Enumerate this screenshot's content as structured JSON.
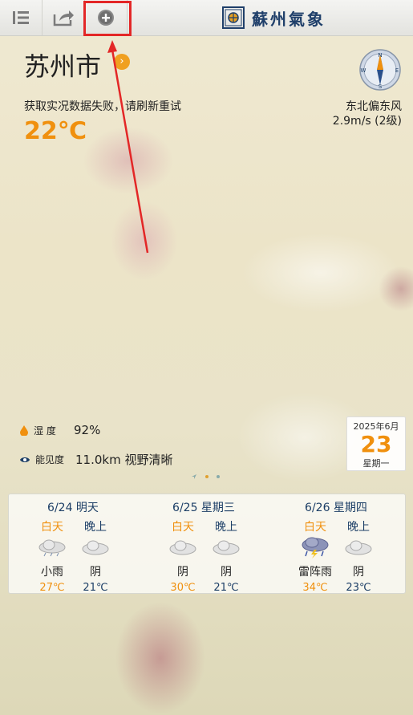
{
  "header": {
    "logo_text": "蘇州氣象",
    "buttons": [
      {
        "name": "menu-icon"
      },
      {
        "name": "share-icon"
      },
      {
        "name": "add-city-icon"
      }
    ]
  },
  "current": {
    "city": "苏州市",
    "status": "获取实况数据失败，请刷新重试",
    "temperature": "22℃",
    "wind_direction": "东北偏东风",
    "wind_speed": "2.9m/s (2级)",
    "compass_letters": {
      "n": "N",
      "s": "S",
      "e": "E",
      "w": "W"
    }
  },
  "details": {
    "humidity_label": "湿 度",
    "humidity_value": "92%",
    "visibility_label": "能见度",
    "visibility_value": "11.0km 视野清晰"
  },
  "date": {
    "year_month": "2025年6月",
    "day": "23",
    "weekday": "星期一"
  },
  "forecast": [
    {
      "date": "6/24 明天",
      "day_label": "白天",
      "night_label": "晚上",
      "day_icon": "rain-cloud-icon",
      "night_icon": "cloud-icon",
      "day_cond": "小雨",
      "night_cond": "阴",
      "day_temp": "27℃",
      "night_temp": "21℃"
    },
    {
      "date": "6/25 星期三",
      "day_label": "白天",
      "night_label": "晚上",
      "day_icon": "cloud-icon",
      "night_icon": "cloud-icon",
      "day_cond": "阴",
      "night_cond": "阴",
      "day_temp": "30℃",
      "night_temp": "21℃"
    },
    {
      "date": "6/26 星期四",
      "day_label": "白天",
      "night_label": "晚上",
      "day_icon": "thunderstorm-icon",
      "night_icon": "cloud-icon",
      "day_cond": "雷阵雨",
      "night_cond": "阴",
      "day_temp": "34℃",
      "night_temp": "23℃"
    }
  ],
  "colors": {
    "accent": "#f0900e",
    "navy": "#1c3e66",
    "highlight": "#e32727"
  }
}
